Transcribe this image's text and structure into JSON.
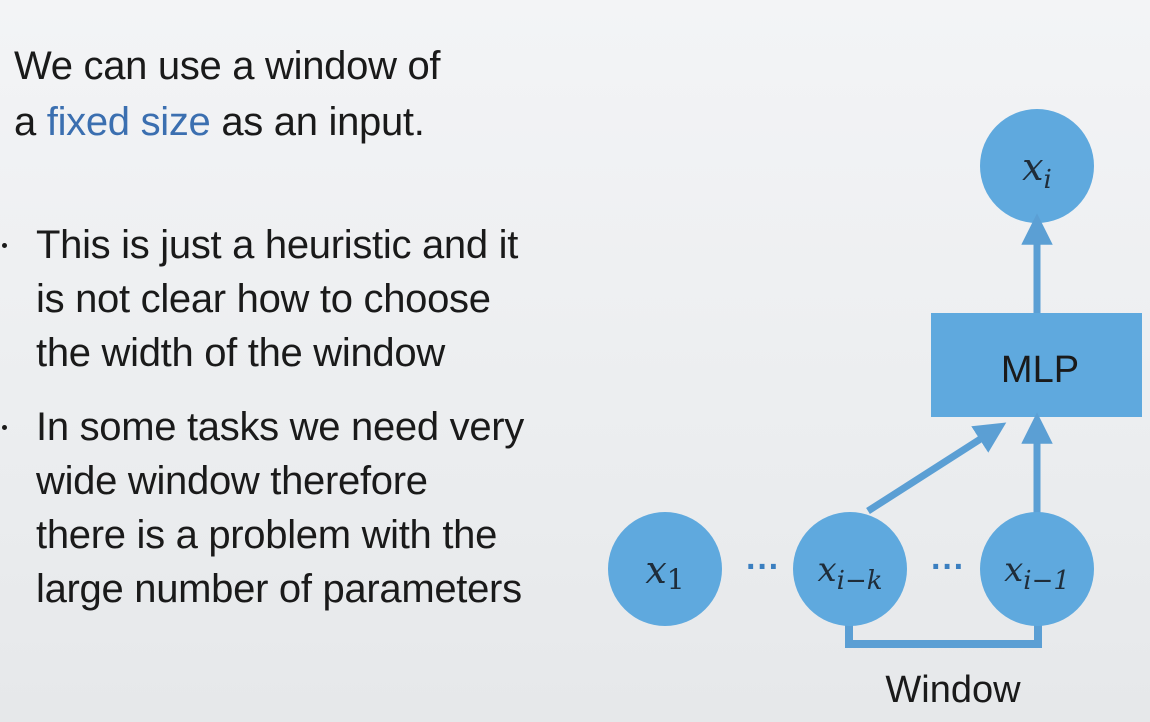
{
  "intro": {
    "line1": "We can use a window of",
    "line2_prefix": "a ",
    "line2_highlight": "fixed size",
    "line2_suffix": " as an input."
  },
  "bullets": [
    {
      "lines": [
        "This is just a heuristic and it",
        "is not clear how to choose",
        "the width of the window"
      ]
    },
    {
      "lines": [
        "In some tasks we need very",
        "wide window therefore",
        "there is a problem with the",
        "large number of parameters"
      ]
    }
  ],
  "diagram": {
    "output_node": "x_i",
    "mlp_label": "MLP",
    "input_nodes": [
      "x_1",
      "x_{i-k}",
      "x_{i-1}"
    ],
    "ellipsis": "···",
    "window_label": "Window"
  },
  "colors": {
    "node_fill": "#5fa9de",
    "arrow": "#5b9fd4",
    "bracket": "#5b9fd4",
    "highlight_text": "#3b6fb0"
  }
}
